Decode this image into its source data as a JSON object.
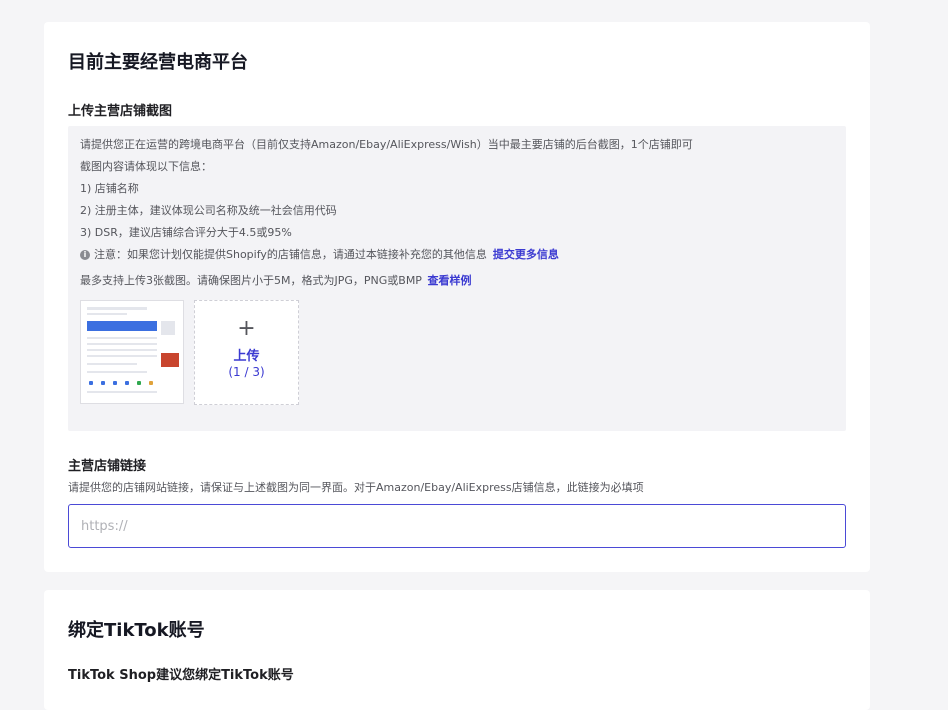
{
  "platform": {
    "title": "目前主要经营电商平台",
    "screenshot_label": "上传主营店铺截图",
    "info": {
      "line1": "请提供您正在运营的跨境电商平台（目前仅支持Amazon/Ebay/AliExpress/Wish）当中最主要店铺的后台截图，1个店铺即可",
      "line2": "截图内容请体现以下信息：",
      "line3": "1) 店铺名称",
      "line4": "2) 注册主体，建议体现公司名称及统一社会信用代码",
      "line5": "3) DSR，建议店铺综合评分大于4.5或95%",
      "note": "注意：如果您计划仅能提供Shopify的店铺信息，请通过本链接补充您的其他信息",
      "note_link": "提交更多信息",
      "upload_hint": "最多支持上传3张截图。请确保图片小于5M，格式为JPG，PNG或BMP",
      "upload_hint_link": "查看样例"
    },
    "upload": {
      "plus": "+",
      "label": "上传",
      "count": "(1 / 3)"
    },
    "link_label": "主营店铺链接",
    "link_helper": "请提供您的店铺网站链接，请保证与上述截图为同一界面。对于Amazon/Ebay/AliExpress店铺信息，此链接为必填项",
    "link_placeholder": "https://",
    "link_value": ""
  },
  "tiktok": {
    "title": "绑定TikTok账号",
    "subtitle": "TikTok Shop建议您绑定TikTok账号"
  },
  "colors": {
    "accent": "#3b3ad1",
    "input_border": "#4b4ad6",
    "info_bg": "#f3f3f6"
  }
}
